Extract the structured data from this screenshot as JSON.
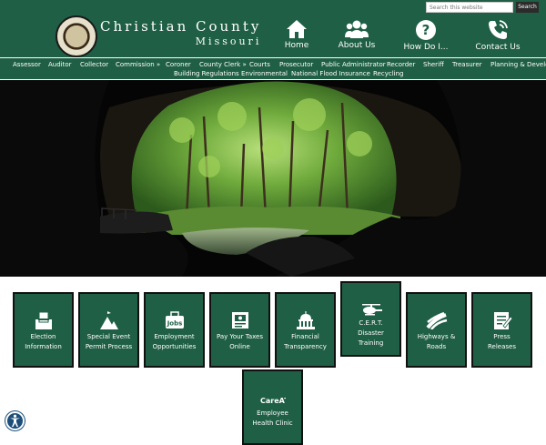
{
  "search": {
    "placeholder": "Search this website",
    "button_label": "Search"
  },
  "site": {
    "name_line1": "Christian County",
    "name_line2": "Missouri"
  },
  "header_nav": [
    {
      "label": "Home",
      "icon": "home-icon"
    },
    {
      "label": "About Us",
      "icon": "people-icon"
    },
    {
      "label": "How Do I...",
      "icon": "question-icon"
    },
    {
      "label": "Contact Us",
      "icon": "phone-icon"
    }
  ],
  "menu": {
    "row1": [
      "Assessor",
      "Auditor",
      "Collector",
      "Commission »",
      "Coroner",
      "County Clerk »",
      "Courts",
      "Prosecutor",
      "Public Administrator",
      "Recorder",
      "Sheriff",
      "Treasurer",
      "Planning & Development"
    ],
    "row2": [
      "Building Regulations",
      "Environmental",
      "National Flood Insurance",
      "Recycling"
    ]
  },
  "tiles": [
    {
      "line1": "Election",
      "line2": "Information",
      "icon": "ballot-box-icon"
    },
    {
      "line1": "Special Event",
      "line2": "Permit Process",
      "icon": "tents-icon"
    },
    {
      "line1": "Employment",
      "line2": "Opportunities",
      "icon": "jobs-icon",
      "icon_text": "Jobs"
    },
    {
      "line1": "Pay Your Taxes",
      "line2": "Online",
      "icon": "tax-bill-icon"
    },
    {
      "line1": "Financial",
      "line2": "Transparency",
      "icon": "capitol-icon"
    },
    {
      "line1": "C.E.R.T.",
      "line2": "Disaster",
      "line3": "Training",
      "icon": "helicopter-icon"
    },
    {
      "line1": "Highways &",
      "line2": "Roads",
      "icon": "highway-icon"
    },
    {
      "line1": "Press",
      "line2": "Releases",
      "icon": "press-release-icon"
    },
    {
      "line1": "Employee",
      "line2": "Health Clinic",
      "icon": "careatc-logo-icon",
      "icon_text": "CareATC"
    }
  ],
  "colors": {
    "brand_green": "#1f5f45",
    "tile_border": "#111111",
    "accessibility_blue": "#1b4f7a"
  }
}
